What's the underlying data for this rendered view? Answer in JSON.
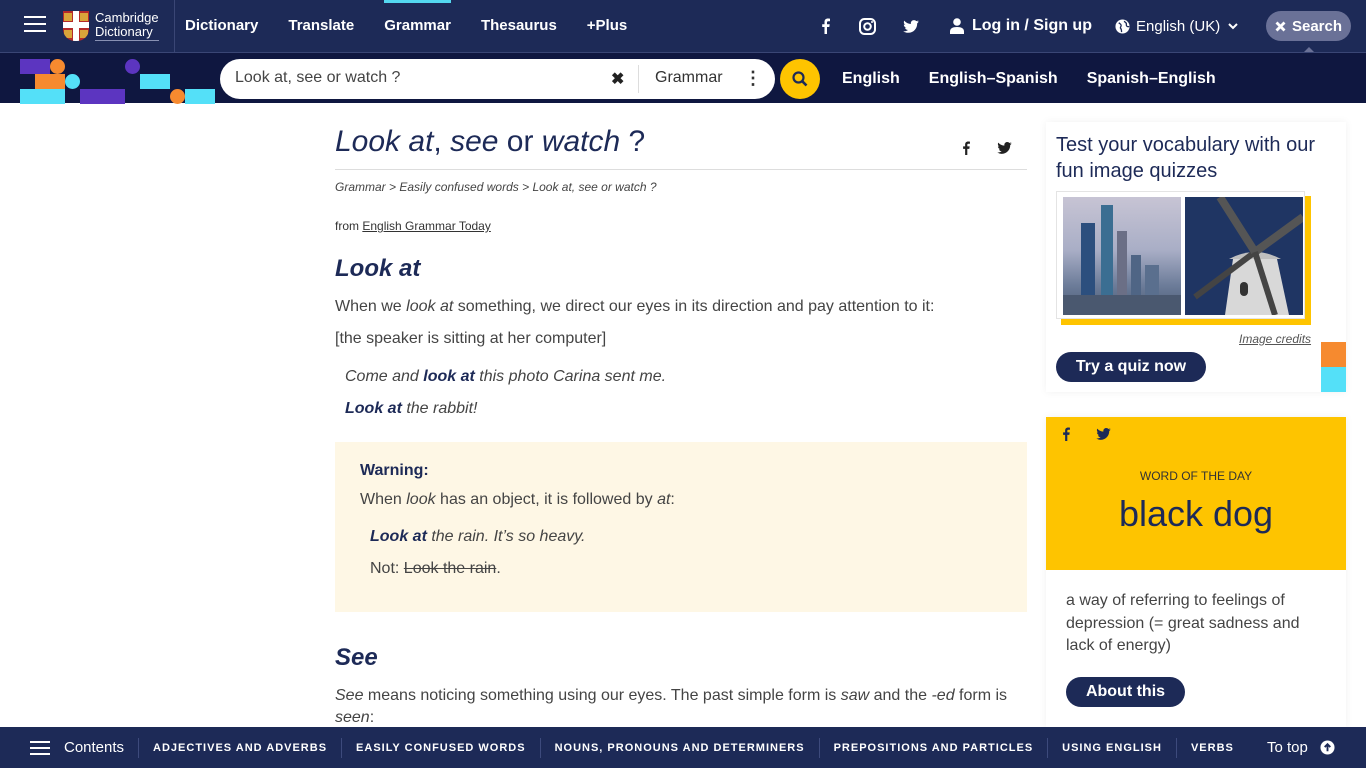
{
  "header": {
    "logo_line1": "Cambridge",
    "logo_line2": "Dictionary",
    "nav": [
      {
        "label": "Dictionary",
        "active": false
      },
      {
        "label": "Translate",
        "active": false
      },
      {
        "label": "Grammar",
        "active": true
      },
      {
        "label": "Thesaurus",
        "active": false
      },
      {
        "label": "+Plus",
        "active": false
      }
    ],
    "social_icons": [
      "facebook-icon",
      "instagram-icon",
      "twitter-icon"
    ],
    "login_label": "Log in / Sign up",
    "language_label": "English (UK)",
    "search_toggle_label": "Search"
  },
  "searchbar": {
    "query": "Look at, see or watch ?",
    "scope": "Grammar",
    "dict_links": [
      "English",
      "English–Spanish",
      "Spanish–English"
    ]
  },
  "article": {
    "title_parts": [
      "Look at",
      ", ",
      "see",
      " or ",
      "watch",
      " ?"
    ],
    "breadcrumb": [
      "Grammar",
      "Easily confused words",
      "Look at, see or watch ?"
    ],
    "breadcrumb_sep": " > ",
    "from_prefix": "from ",
    "from_link": "English Grammar Today",
    "section1": {
      "heading": "Look at",
      "para1": {
        "a": "When we ",
        "b": "look at",
        "c": " something, we direct our eyes in its direction and pay attention to it:"
      },
      "context": "[the speaker is sitting at her computer]",
      "example1": {
        "a": "Come and ",
        "b": "look at",
        "c": " this photo Carina sent me."
      },
      "example2": {
        "b": "Look at",
        "c": " the rabbit!"
      }
    },
    "warning": {
      "title": "Warning:",
      "para": {
        "a": "When ",
        "b": "look",
        "c": " has an object, it is followed by ",
        "d": "at",
        "e": ":"
      },
      "example": {
        "b": "Look at",
        "c": " the rain. It’s so heavy."
      },
      "not_prefix": "Not: ",
      "not_struck": "Look the rain",
      "not_suffix": "."
    },
    "section2": {
      "heading": "See",
      "para": {
        "a": "See",
        "b": " means noticing something using our eyes. The past simple form is ",
        "c": "saw",
        "d": " and the ",
        "e": "-ed",
        "f": " form is ",
        "g": "seen",
        "h": ":"
      }
    }
  },
  "sidebar": {
    "quiz": {
      "title": "Test your vocabulary with our fun image quizzes",
      "credits": "Image credits",
      "button": "Try a quiz now"
    },
    "wotd": {
      "label": "WORD OF THE DAY",
      "word": "black dog",
      "definition": "a way of referring to feelings of depression (= great sadness and lack of energy)",
      "button": "About this"
    }
  },
  "bottombar": {
    "contents_label": "Contents",
    "links": [
      "ADJECTIVES AND ADVERBS",
      "EASILY CONFUSED WORDS",
      "NOUNS, PRONOUNS AND DETERMINERS",
      "PREPOSITIONS AND PARTICLES",
      "USING ENGLISH",
      "VERBS"
    ],
    "to_top_label": "To top"
  },
  "colors": {
    "navy": "#1d2a57",
    "dark_navy": "#0f1740",
    "yellow": "#fec400",
    "cyan": "#54e0f8",
    "orange": "#f68a2f",
    "purple": "#5c35c0",
    "warning_bg": "#fef7e5"
  }
}
